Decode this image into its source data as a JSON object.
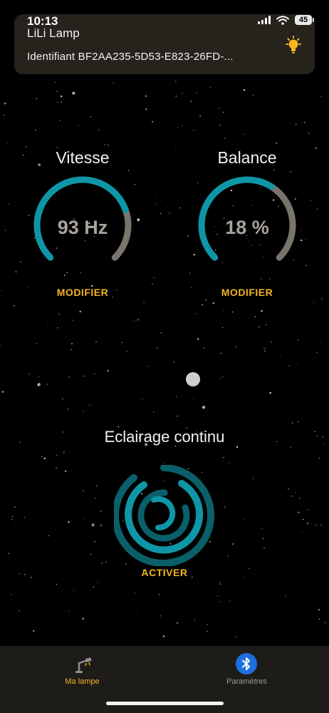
{
  "status_bar": {
    "time": "10:13",
    "battery": "45"
  },
  "header": {
    "title": "LiLi Lamp",
    "device_id": "Identifiant BF2AA235-5D53-E823-26FD-...",
    "icon": "lightbulb-icon"
  },
  "gauges": [
    {
      "title": "Vitesse",
      "value": "93 Hz",
      "level": 0.76,
      "action": "MODIFIER"
    },
    {
      "title": "Balance",
      "value": "18 %",
      "level": 0.62,
      "action": "MODIFIER"
    }
  ],
  "continuous_lighting": {
    "title": "Eclairage continu",
    "action": "ACTIVER"
  },
  "tabs": [
    {
      "label": "Ma lampe",
      "icon": "lamp-icon",
      "active": true
    },
    {
      "label": "Paramètres",
      "icon": "bluetooth-icon",
      "active": false
    }
  ],
  "colors": {
    "accent_teal": "#0f96a6",
    "dark_teal": "#0b5f69",
    "gauge_track": "#7a756c",
    "action_yellow": "#f3b521",
    "active_tab": "#f3b521",
    "inactive_tab": "#9a9a9a",
    "card_bg": "#26231d"
  }
}
